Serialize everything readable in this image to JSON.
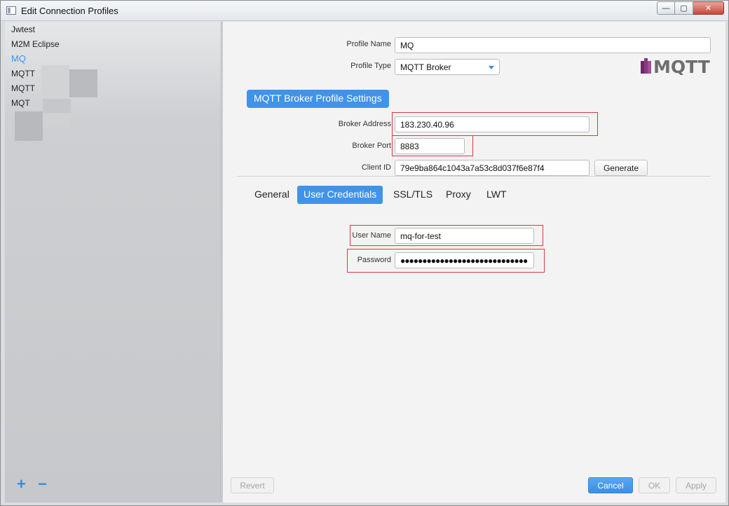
{
  "window": {
    "title": "Edit Connection Profiles",
    "minimize_label": "—",
    "maximize_label": "▢",
    "close_label": "✕"
  },
  "sidebar": {
    "items": [
      {
        "label": "Jwtest"
      },
      {
        "label": "M2M Eclipse"
      },
      {
        "label": "MQ",
        "selected": true
      },
      {
        "label": "MQTT"
      },
      {
        "label": "MQTT"
      },
      {
        "label": "MQT"
      }
    ],
    "add_label": "+",
    "remove_label": "−"
  },
  "profile": {
    "name_label": "Profile Name",
    "name_value": "MQ",
    "type_label": "Profile Type",
    "type_value": "MQTT Broker",
    "logo_text": "MQTT"
  },
  "broker_settings": {
    "header": "MQTT Broker Profile Settings",
    "address_label": "Broker Address",
    "address_value": "183.230.40.96",
    "port_label": "Broker Port",
    "port_value": "8883",
    "client_id_label": "Client ID",
    "client_id_value": "79e9ba864c1043a7a53c8d037f6e87f4",
    "generate_label": "Generate"
  },
  "tabs": [
    {
      "label": "General"
    },
    {
      "label": "User Credentials",
      "active": true
    },
    {
      "label": "SSL/TLS"
    },
    {
      "label": "Proxy"
    },
    {
      "label": "LWT"
    }
  ],
  "credentials": {
    "username_label": "User Name",
    "username_value": "mq-for-test",
    "password_label": "Password",
    "password_value": "●●●●●●●●●●●●●●●●●●●●●●●●●●●●●"
  },
  "footer": {
    "revert_label": "Revert",
    "cancel_label": "Cancel",
    "ok_label": "OK",
    "apply_label": "Apply"
  },
  "colors": {
    "accent": "#3f93ea",
    "highlight_border": "#d9383f",
    "selected_item": "#3b97f0"
  }
}
